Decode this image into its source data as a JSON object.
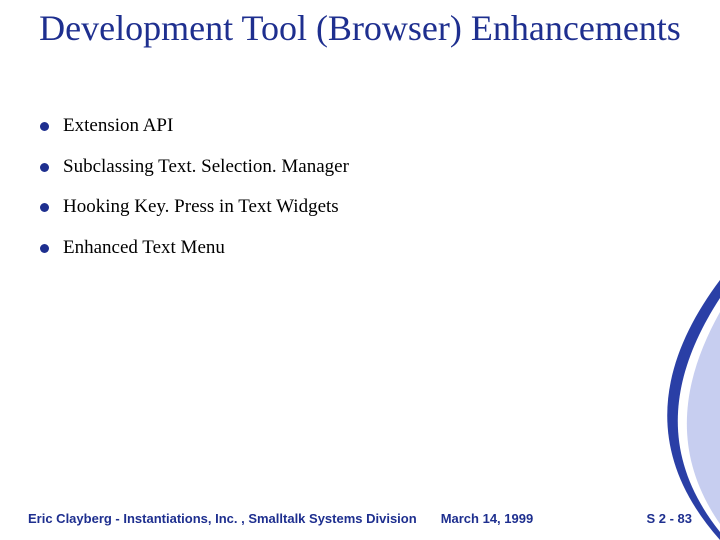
{
  "title": "Development Tool (Browser) Enhancements",
  "bullets": [
    "Extension API",
    "Subclassing Text. Selection. Manager",
    "Hooking Key. Press in Text Widgets",
    "Enhanced Text Menu"
  ],
  "footer": {
    "author": "Eric Clayberg - Instantiations, Inc. , Smalltalk Systems Division",
    "date": "March 14, 1999",
    "page": "S 2 - 83"
  },
  "colors": {
    "accent": "#1e2f8f"
  }
}
